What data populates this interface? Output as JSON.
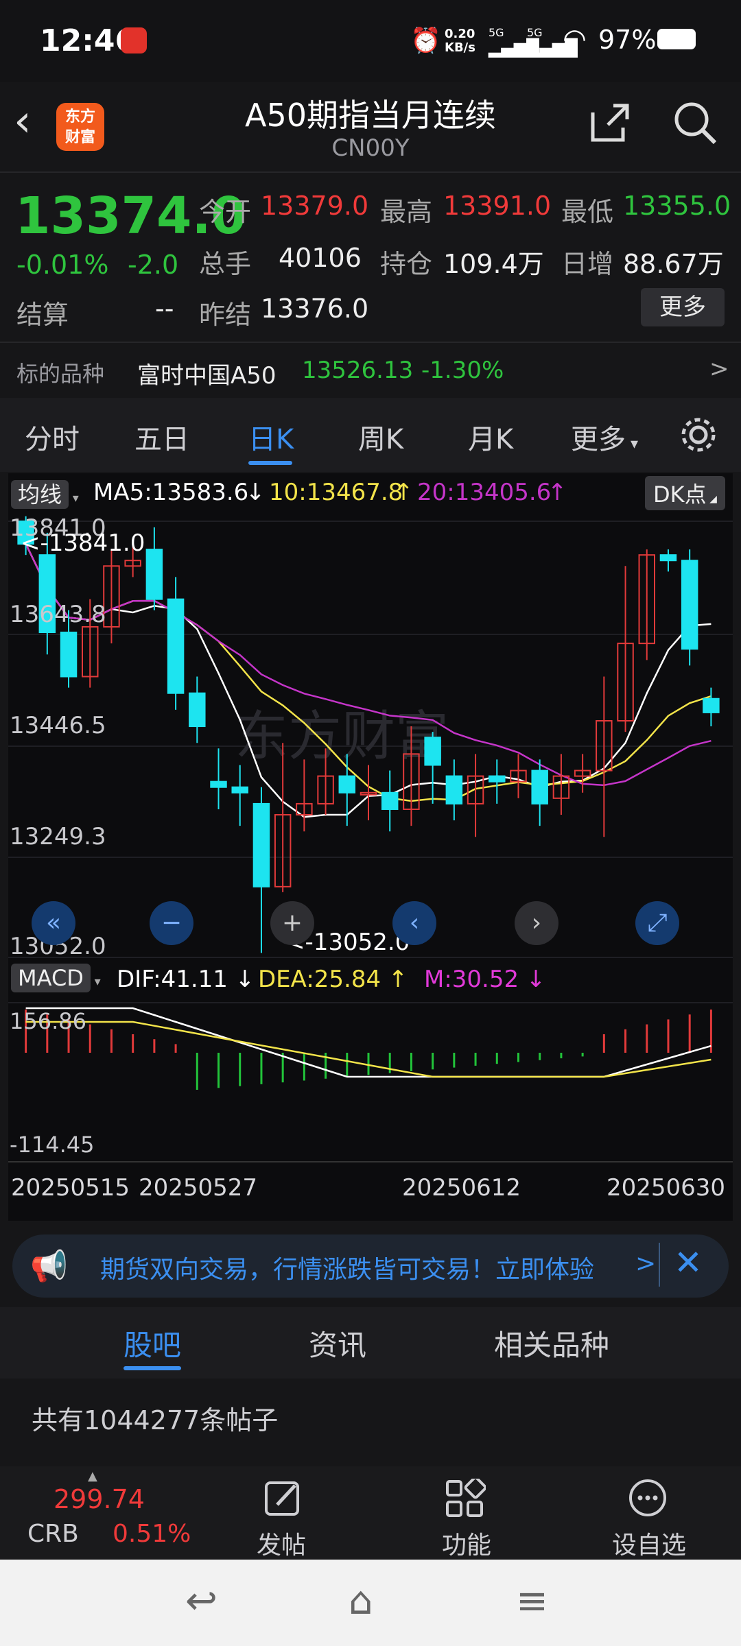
{
  "status_bar": {
    "time": "12:46",
    "speed": "0.20",
    "speed_unit": "KB/s",
    "net1": "5G",
    "net2": "5G",
    "battery": "97%"
  },
  "header": {
    "logo_line1": "东方",
    "logo_line2": "财富",
    "title": "A50期指当月连续",
    "subtitle": "CN00Y"
  },
  "quote": {
    "price": "13374.0",
    "change_pct": "-0.01%",
    "change": "-2.0",
    "open_label": "今开",
    "open": "13379.0",
    "high_label": "最高",
    "high": "13391.0",
    "low_label": "最低",
    "low": "13355.0",
    "volume_label": "总手",
    "volume": "40106",
    "position_label": "持仓",
    "position": "109.4万",
    "daily_inc_label": "日增",
    "daily_inc": "88.67万",
    "settle_label": "结算",
    "settle": "--",
    "prev_settle_label": "昨结",
    "prev_settle": "13376.0",
    "more_label": "更多"
  },
  "underlying": {
    "label": "标的品种",
    "name": "富时中国A50",
    "price": "13526.13",
    "change_pct": "-1.30%",
    "arrow": ">"
  },
  "chart_tabs": [
    {
      "label": "分时"
    },
    {
      "label": "五日"
    },
    {
      "label": "日K"
    },
    {
      "label": "周K"
    },
    {
      "label": "月K"
    },
    {
      "label": "更多"
    }
  ],
  "kline": {
    "indicator_label": "均线",
    "ma5": "MA5:13583.6",
    "ma10": "10:13467.8",
    "ma20": "20:13405.6",
    "dk_label": "DK点",
    "y_ticks": [
      "13841.0",
      "13643.8",
      "13446.5",
      "13249.3",
      "13052.0"
    ],
    "max_note": "<-13841.0",
    "min_note": "<-13052.0",
    "watermark": "东方财富"
  },
  "macd": {
    "label": "MACD",
    "dif": "DIF:41.11",
    "dea": "DEA:25.84",
    "m": "M:30.52",
    "top": "156.86",
    "bottom": "-114.45"
  },
  "x_dates": [
    "20250515",
    "20250527",
    "20250612",
    "20250630"
  ],
  "colors": {
    "up": "#e23a3a",
    "down": "#1de4f0",
    "ma5": "#ffffff",
    "ma10": "#f3e44a",
    "ma20": "#c535c9",
    "accent": "#3b8ff0"
  },
  "banner": {
    "text": "期货双向交易，行情涨跌皆可交易！立即体验",
    "arrow": ">"
  },
  "bottom_tabs": [
    {
      "label": "股吧"
    },
    {
      "label": "资讯"
    },
    {
      "label": "相关品种"
    }
  ],
  "posts_count": "共有1044277条帖子",
  "bottom_bar": {
    "crb_value": "299.74",
    "crb_label": "CRB",
    "crb_change": "0.51%",
    "post_label": "发帖",
    "function_label": "功能",
    "watch_label": "设自选"
  }
}
